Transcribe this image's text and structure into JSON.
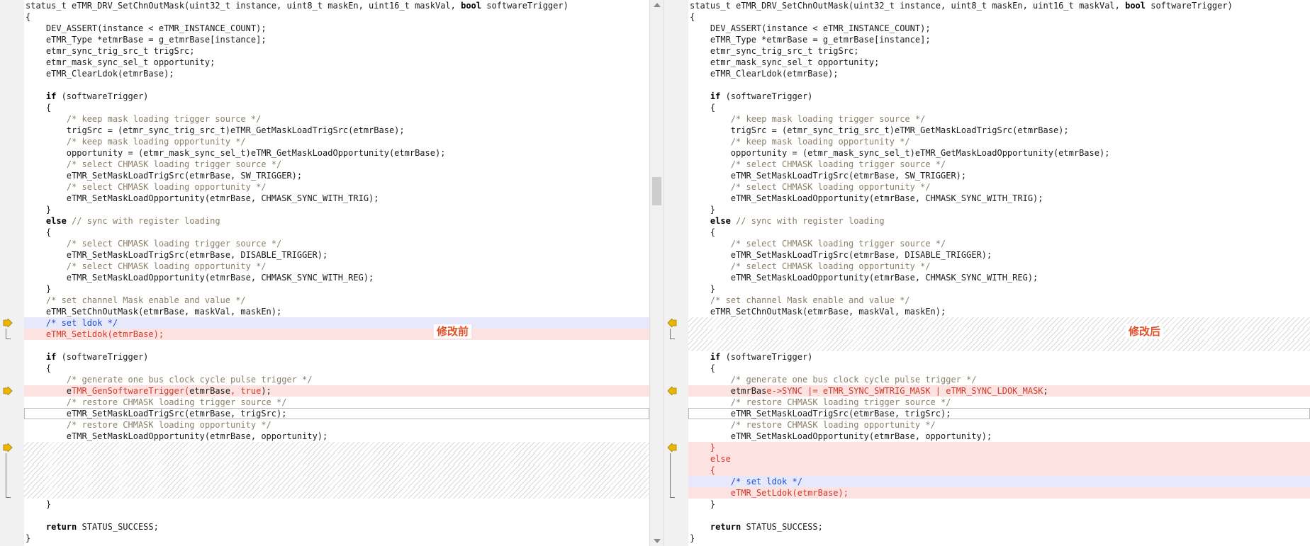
{
  "app": {
    "left_label": "修改前",
    "right_label": "修改后"
  },
  "left": {
    "lines": [
      [
        {
          "t": "status_t eTMR_DRV_SetChnOutMask(uint32_t instance, uint8_t maskEn, uint16_t maskVal, ",
          "c": "txt"
        },
        {
          "t": "bool",
          "c": "kw"
        },
        {
          "t": " softwareTrigger)",
          "c": "txt"
        }
      ],
      [
        {
          "t": "{",
          "c": "txt"
        }
      ],
      [
        {
          "t": "    DEV_ASSERT(instance < eTMR_INSTANCE_COUNT);",
          "c": "txt"
        }
      ],
      [
        {
          "t": "    eTMR_Type *etmrBase = g_etmrBase[instance];",
          "c": "txt"
        }
      ],
      [
        {
          "t": "    etmr_sync_trig_src_t trigSrc;",
          "c": "txt"
        }
      ],
      [
        {
          "t": "    etmr_mask_sync_sel_t opportunity;",
          "c": "txt"
        }
      ],
      [
        {
          "t": "    eTMR_ClearLdok(etmrBase);",
          "c": "txt"
        }
      ],
      [],
      [
        {
          "t": "    ",
          "c": "txt"
        },
        {
          "t": "if",
          "c": "kw"
        },
        {
          "t": " (softwareTrigger)",
          "c": "txt"
        }
      ],
      [
        {
          "t": "    {",
          "c": "txt"
        }
      ],
      [
        {
          "t": "        /* keep mask loading trigger source */",
          "c": "cm"
        }
      ],
      [
        {
          "t": "        trigSrc = (etmr_sync_trig_src_t)eTMR_GetMaskLoadTrigSrc(etmrBase);",
          "c": "txt"
        }
      ],
      [
        {
          "t": "        /* keep mask loading opportunity */",
          "c": "cm"
        }
      ],
      [
        {
          "t": "        opportunity = (etmr_mask_sync_sel_t)eTMR_GetMaskLoadOpportunity(etmrBase);",
          "c": "txt"
        }
      ],
      [
        {
          "t": "        /* select CHMASK loading trigger source */",
          "c": "cm"
        }
      ],
      [
        {
          "t": "        eTMR_SetMaskLoadTrigSrc(etmrBase, SW_TRIGGER);",
          "c": "txt"
        }
      ],
      [
        {
          "t": "        /* select CHMASK loading opportunity */",
          "c": "cm"
        }
      ],
      [
        {
          "t": "        eTMR_SetMaskLoadOpportunity(etmrBase, CHMASK_SYNC_WITH_TRIG);",
          "c": "txt"
        }
      ],
      [
        {
          "t": "    }",
          "c": "txt"
        }
      ],
      [
        {
          "t": "    ",
          "c": "txt"
        },
        {
          "t": "else",
          "c": "kw"
        },
        {
          "t": " // sync with register loading",
          "c": "cm"
        }
      ],
      [
        {
          "t": "    {",
          "c": "txt"
        }
      ],
      [
        {
          "t": "        /* select CHMASK loading trigger source */",
          "c": "cm"
        }
      ],
      [
        {
          "t": "        eTMR_SetMaskLoadTrigSrc(etmrBase, DISABLE_TRIGGER);",
          "c": "txt"
        }
      ],
      [
        {
          "t": "        /* select CHMASK loading opportunity */",
          "c": "cm"
        }
      ],
      [
        {
          "t": "        eTMR_SetMaskLoadOpportunity(etmrBase, CHMASK_SYNC_WITH_REG);",
          "c": "txt"
        }
      ],
      [
        {
          "t": "    }",
          "c": "txt"
        }
      ],
      [
        {
          "t": "    /* set channel Mask enable and value */",
          "c": "cm"
        }
      ],
      [
        {
          "t": "    eTMR_SetChnOutMask(etmrBase, maskVal, maskEn);",
          "c": "txt"
        }
      ],
      [
        {
          "t": "    /* set ldok */",
          "c": "cm blue"
        }
      ],
      [
        {
          "t": "    eTMR_SetLdok(etmrBase);",
          "c": "red"
        }
      ],
      [],
      [
        {
          "t": "    ",
          "c": "txt"
        },
        {
          "t": "if",
          "c": "kw"
        },
        {
          "t": " (softwareTrigger)",
          "c": "txt"
        }
      ],
      [
        {
          "t": "    {",
          "c": "txt"
        }
      ],
      [
        {
          "t": "        /* generate one bus clock cycle pulse trigger */",
          "c": "cm"
        }
      ],
      [
        {
          "t": "        e",
          "c": "txt"
        },
        {
          "t": "TMR_GenSoftwareTrigger(",
          "c": "red"
        },
        {
          "t": "etmrBase",
          "c": "txt"
        },
        {
          "t": ", true",
          "c": "red"
        },
        {
          "t": ");",
          "c": "txt"
        }
      ],
      [
        {
          "t": "        /* restore CHMASK loading trigger source */",
          "c": "cm"
        }
      ],
      [
        {
          "t": "        eTMR_SetMaskLoadTrigSrc(etmrBase, trigSrc);",
          "c": "txt"
        }
      ],
      [
        {
          "t": "        /* restore CHMASK loading opportunity */",
          "c": "cm"
        }
      ],
      [
        {
          "t": "        eTMR_SetMaskLoadOpportunity(etmrBase, opportunity);",
          "c": "txt"
        }
      ],
      [],
      [],
      [],
      [],
      [],
      [
        {
          "t": "    }",
          "c": "txt"
        }
      ],
      [],
      [
        {
          "t": "    ",
          "c": "txt"
        },
        {
          "t": "return",
          "c": "kw"
        },
        {
          "t": " STATUS_SUCCESS;",
          "c": "txt"
        }
      ],
      [
        {
          "t": "}",
          "c": "txt"
        }
      ]
    ]
  },
  "right": {
    "lines": [
      [
        {
          "t": "status_t eTMR_DRV_SetChnOutMask(uint32_t instance, uint8_t maskEn, uint16_t maskVal, ",
          "c": "txt"
        },
        {
          "t": "bool",
          "c": "kw"
        },
        {
          "t": " softwareTrigger)",
          "c": "txt"
        }
      ],
      [
        {
          "t": "{",
          "c": "txt"
        }
      ],
      [
        {
          "t": "    DEV_ASSERT(instance < eTMR_INSTANCE_COUNT);",
          "c": "txt"
        }
      ],
      [
        {
          "t": "    eTMR_Type *etmrBase = g_etmrBase[instance];",
          "c": "txt"
        }
      ],
      [
        {
          "t": "    etmr_sync_trig_src_t trigSrc;",
          "c": "txt"
        }
      ],
      [
        {
          "t": "    etmr_mask_sync_sel_t opportunity;",
          "c": "txt"
        }
      ],
      [
        {
          "t": "    eTMR_ClearLdok(etmrBase);",
          "c": "txt"
        }
      ],
      [],
      [
        {
          "t": "    ",
          "c": "txt"
        },
        {
          "t": "if",
          "c": "kw"
        },
        {
          "t": " (softwareTrigger)",
          "c": "txt"
        }
      ],
      [
        {
          "t": "    {",
          "c": "txt"
        }
      ],
      [
        {
          "t": "        /* keep mask loading trigger source */",
          "c": "cm"
        }
      ],
      [
        {
          "t": "        trigSrc = (etmr_sync_trig_src_t)eTMR_GetMaskLoadTrigSrc(etmrBase);",
          "c": "txt"
        }
      ],
      [
        {
          "t": "        /* keep mask loading opportunity */",
          "c": "cm"
        }
      ],
      [
        {
          "t": "        opportunity = (etmr_mask_sync_sel_t)eTMR_GetMaskLoadOpportunity(etmrBase);",
          "c": "txt"
        }
      ],
      [
        {
          "t": "        /* select CHMASK loading trigger source */",
          "c": "cm"
        }
      ],
      [
        {
          "t": "        eTMR_SetMaskLoadTrigSrc(etmrBase, SW_TRIGGER);",
          "c": "txt"
        }
      ],
      [
        {
          "t": "        /* select CHMASK loading opportunity */",
          "c": "cm"
        }
      ],
      [
        {
          "t": "        eTMR_SetMaskLoadOpportunity(etmrBase, CHMASK_SYNC_WITH_TRIG);",
          "c": "txt"
        }
      ],
      [
        {
          "t": "    }",
          "c": "txt"
        }
      ],
      [
        {
          "t": "    ",
          "c": "txt"
        },
        {
          "t": "else",
          "c": "kw"
        },
        {
          "t": " // sync with register loading",
          "c": "cm"
        }
      ],
      [
        {
          "t": "    {",
          "c": "txt"
        }
      ],
      [
        {
          "t": "        /* select CHMASK loading trigger source */",
          "c": "cm"
        }
      ],
      [
        {
          "t": "        eTMR_SetMaskLoadTrigSrc(etmrBase, DISABLE_TRIGGER);",
          "c": "txt"
        }
      ],
      [
        {
          "t": "        /* select CHMASK loading opportunity */",
          "c": "cm"
        }
      ],
      [
        {
          "t": "        eTMR_SetMaskLoadOpportunity(etmrBase, CHMASK_SYNC_WITH_REG);",
          "c": "txt"
        }
      ],
      [
        {
          "t": "    }",
          "c": "txt"
        }
      ],
      [
        {
          "t": "    /* set channel Mask enable and value */",
          "c": "cm"
        }
      ],
      [
        {
          "t": "    eTMR_SetChnOutMask(etmrBase, maskVal, maskEn);",
          "c": "txt"
        }
      ],
      [],
      [],
      [],
      [
        {
          "t": "    ",
          "c": "txt"
        },
        {
          "t": "if",
          "c": "kw"
        },
        {
          "t": " (softwareTrigger)",
          "c": "txt"
        }
      ],
      [
        {
          "t": "    {",
          "c": "txt"
        }
      ],
      [
        {
          "t": "        /* generate one bus clock cycle pulse trigger */",
          "c": "cm"
        }
      ],
      [
        {
          "t": "        etmrBas",
          "c": "txt"
        },
        {
          "t": "e->SYNC |= e",
          "c": "red"
        },
        {
          "t": "TMR_SYNC_SWTRIG_MASK | eTMR_SYNC_LDOK_MASK",
          "c": "red"
        },
        {
          "t": ";",
          "c": "txt"
        }
      ],
      [
        {
          "t": "        /* restore CHMASK loading trigger source */",
          "c": "cm"
        }
      ],
      [
        {
          "t": "        eTMR_SetMaskLoadTrigSrc(etmrBase, trigSrc);",
          "c": "txt"
        }
      ],
      [
        {
          "t": "        /* restore CHMASK loading opportunity */",
          "c": "cm"
        }
      ],
      [
        {
          "t": "        eTMR_SetMaskLoadOpportunity(etmrBase, opportunity);",
          "c": "txt"
        }
      ],
      [
        {
          "t": "    }",
          "c": "red"
        }
      ],
      [
        {
          "t": "    else",
          "c": "red"
        }
      ],
      [
        {
          "t": "    {",
          "c": "red"
        }
      ],
      [
        {
          "t": "        /* set ldok */",
          "c": "cm blue"
        }
      ],
      [
        {
          "t": "        eTMR_SetLdok(etmrBase);",
          "c": "red"
        }
      ],
      [
        {
          "t": "    }",
          "c": "txt"
        }
      ],
      [],
      [
        {
          "t": "    ",
          "c": "txt"
        },
        {
          "t": "return",
          "c": "kw"
        },
        {
          "t": " STATUS_SUCCESS;",
          "c": "txt"
        }
      ],
      [
        {
          "t": "}",
          "c": "txt"
        }
      ]
    ]
  },
  "colors": {
    "deleted_bg": "#fde2e2",
    "selected_bg": "#e8e8fb",
    "label": "#e0502a",
    "marker": "#e8b800"
  }
}
